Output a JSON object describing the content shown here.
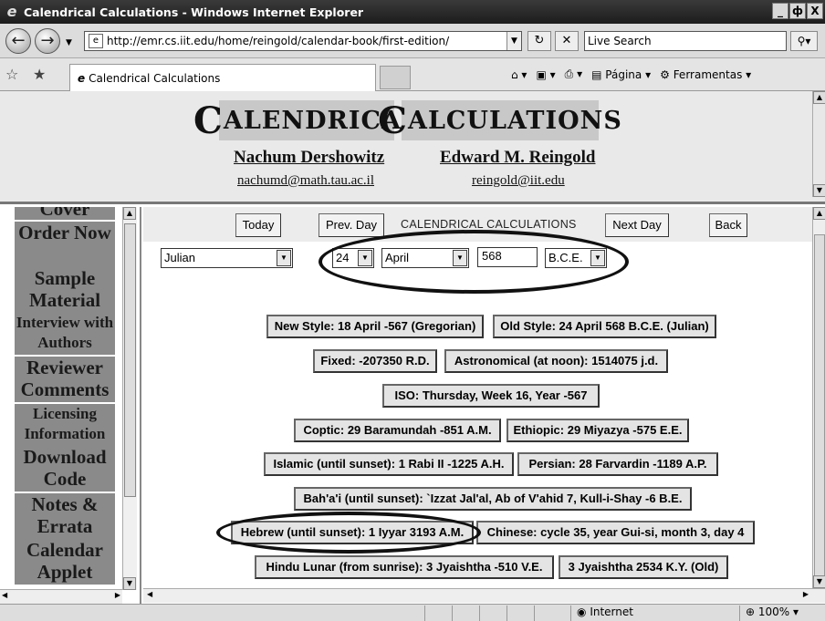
{
  "window": {
    "title": "Calendrical Calculations - Windows Internet Explorer",
    "minimize": "_",
    "restore": "ф",
    "close": "X"
  },
  "address_bar": {
    "url": "http://emr.cs.iit.edu/home/reingold/calendar-book/first-edition/",
    "search_placeholder": "Live Search"
  },
  "tab": {
    "label": "Calendrical Calculations"
  },
  "command_bar": {
    "page": "Página",
    "tools": "Ferramentas"
  },
  "banner": {
    "logo_left_big": "C",
    "logo_left_rest": "ALENDRICAL",
    "logo_right_big": "C",
    "logo_right_rest": "ALCULATIONS",
    "author1": "Nachum Dershowitz",
    "author2": "Edward M. Reingold",
    "email1": "nachumd@math.tau.ac.il",
    "email2": "reingold@iit.edu"
  },
  "sidebar": {
    "items": [
      {
        "label": "Cover"
      },
      {
        "label": "Order Now"
      },
      {
        "label": "Sample Material"
      },
      {
        "label": "Interview with Authors"
      },
      {
        "label": "Reviewer Comments"
      },
      {
        "label": "Licensing Information"
      },
      {
        "label": "Download Code"
      },
      {
        "label": "Notes & Errata"
      },
      {
        "label": "Calendar Applet"
      }
    ]
  },
  "controls": {
    "today": "Today",
    "prev_day": "Prev. Day",
    "center_label": "CALENDRICAL CALCULATIONS",
    "next_day": "Next Day",
    "back": "Back",
    "calendar_select": "Julian",
    "day_select": "24",
    "month_select": "April",
    "year_value": "568",
    "era_select": "B.C.E."
  },
  "results": [
    "New Style: 18 April -567 (Gregorian)",
    "Old Style: 24 April 568 B.C.E. (Julian)",
    "Fixed: -207350 R.D.",
    "Astronomical (at noon): 1514075 j.d.",
    "ISO: Thursday, Week 16, Year -567",
    "Coptic: 29 Baramundah -851 A.M.",
    "Ethiopic: 29 Miyazya -575 E.E.",
    "Islamic (until sunset): 1 Rabi II -1225 A.H.",
    "Persian: 28 Farvardin -1189 A.P.",
    "Bah'a'i (until sunset): `Izzat Jal'al, Ab of V'ahid 7, Kull-i-Shay -6 B.E.",
    "Hebrew (until sunset): 1 Iyyar 3193 A.M.",
    "Chinese: cycle 35, year Gui-si, month 3, day 4",
    "Hindu Lunar (from sunrise): 3 Jyaishtha -510 V.E.",
    "3 Jyaishtha 2534 K.Y. (Old)"
  ],
  "status_bar": {
    "zone": "Internet",
    "zoom": "100%"
  }
}
